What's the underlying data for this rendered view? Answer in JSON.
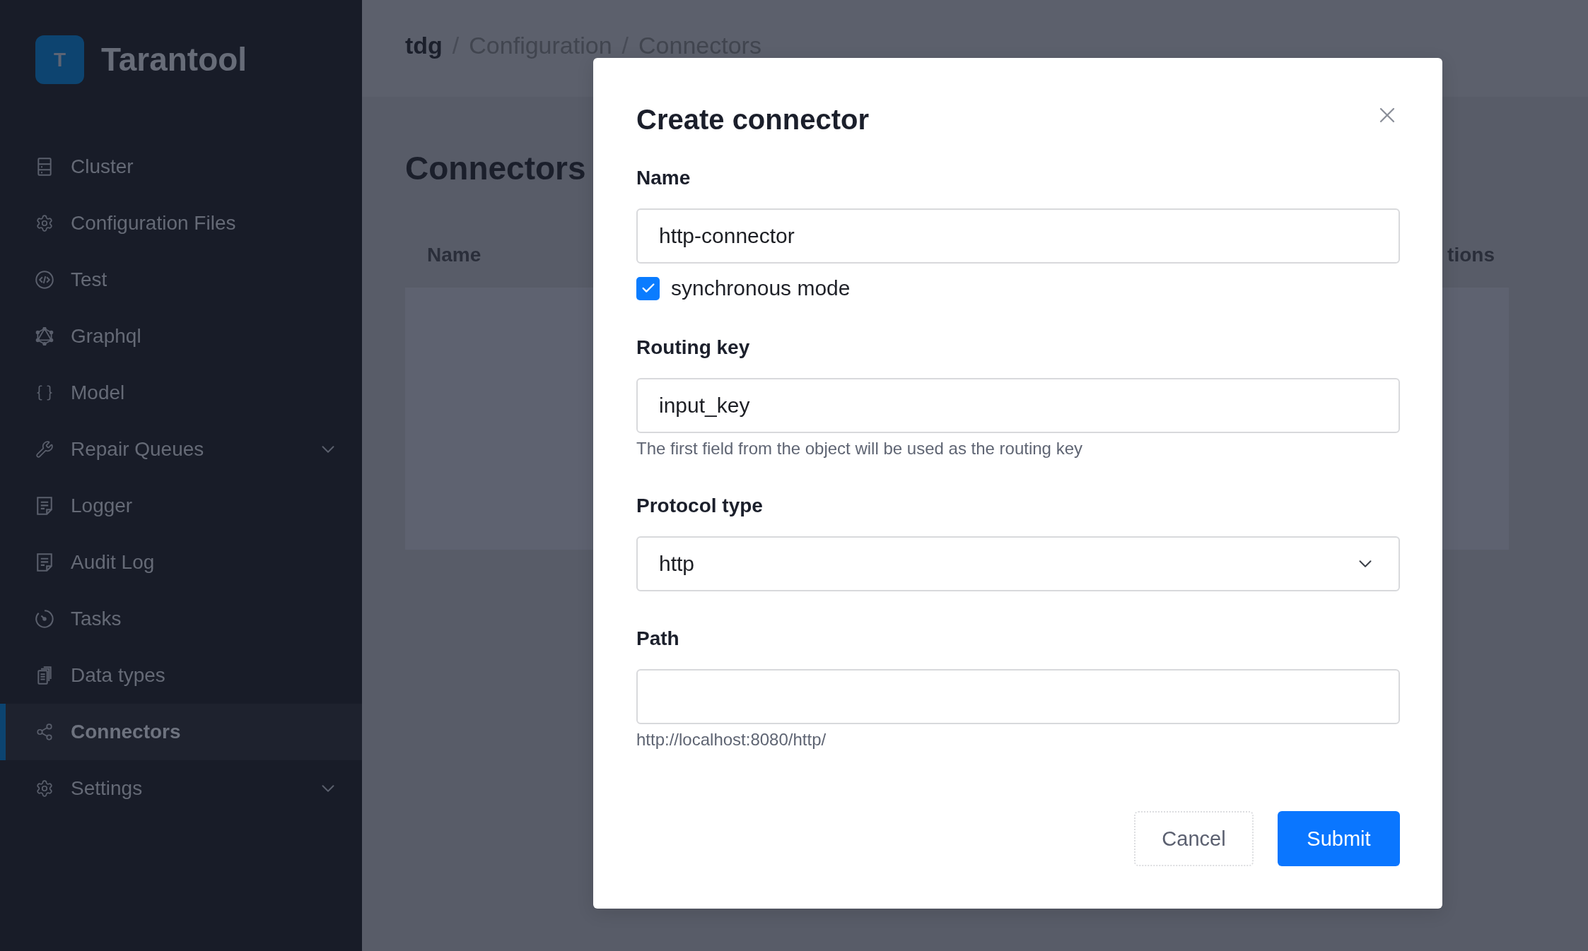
{
  "sidebar": {
    "logo": {
      "mark": "T",
      "name": "Tarantool"
    },
    "items": [
      {
        "label": "Cluster",
        "kind": "link",
        "selected": false
      },
      {
        "label": "Configuration Files",
        "kind": "link",
        "selected": false
      },
      {
        "label": "Test",
        "kind": "link",
        "selected": false
      },
      {
        "label": "Graphql",
        "kind": "link",
        "selected": false
      },
      {
        "label": "Model",
        "kind": "link",
        "selected": false
      },
      {
        "label": "Repair Queues",
        "kind": "group",
        "expanded": false,
        "selected": false
      },
      {
        "label": "Logger",
        "kind": "link",
        "selected": false
      },
      {
        "label": "Audit Log",
        "kind": "link",
        "selected": false
      },
      {
        "label": "Tasks",
        "kind": "link",
        "selected": false
      },
      {
        "label": "Data types",
        "kind": "link",
        "selected": false
      },
      {
        "label": "Connectors",
        "kind": "link",
        "selected": true
      },
      {
        "label": "Settings",
        "kind": "group",
        "expanded": false,
        "selected": false
      }
    ]
  },
  "header": {
    "breadcrumb": [
      {
        "kind": "root",
        "text": "tdg"
      },
      {
        "kind": "separator",
        "text": "/"
      },
      {
        "kind": "crumb",
        "text": "Configuration"
      },
      {
        "kind": "separator",
        "text": "/"
      },
      {
        "kind": "crumb",
        "text": "Connectors"
      }
    ]
  },
  "page": {
    "title": "Connectors",
    "table": {
      "columns": [
        {
          "label": "Name"
        },
        {
          "label": "tions"
        }
      ]
    }
  },
  "modal": {
    "title": "Create connector",
    "fields": [
      {
        "kind": "text",
        "label": "Name",
        "value": "http-connector"
      },
      {
        "kind": "checkbox",
        "label": "synchronous mode",
        "checked": true
      },
      {
        "kind": "text",
        "label": "Routing key",
        "value": "input_key",
        "hint": "The first field from the object will be used as the routing key"
      },
      {
        "kind": "select",
        "label": "Protocol type",
        "value": "http"
      },
      {
        "kind": "text",
        "label": "Path",
        "hint": "http://localhost:8080/http/"
      }
    ],
    "buttons": [
      {
        "label": "Cancel",
        "kind": "secondary"
      },
      {
        "label": "Submit",
        "kind": "primary"
      }
    ]
  }
}
